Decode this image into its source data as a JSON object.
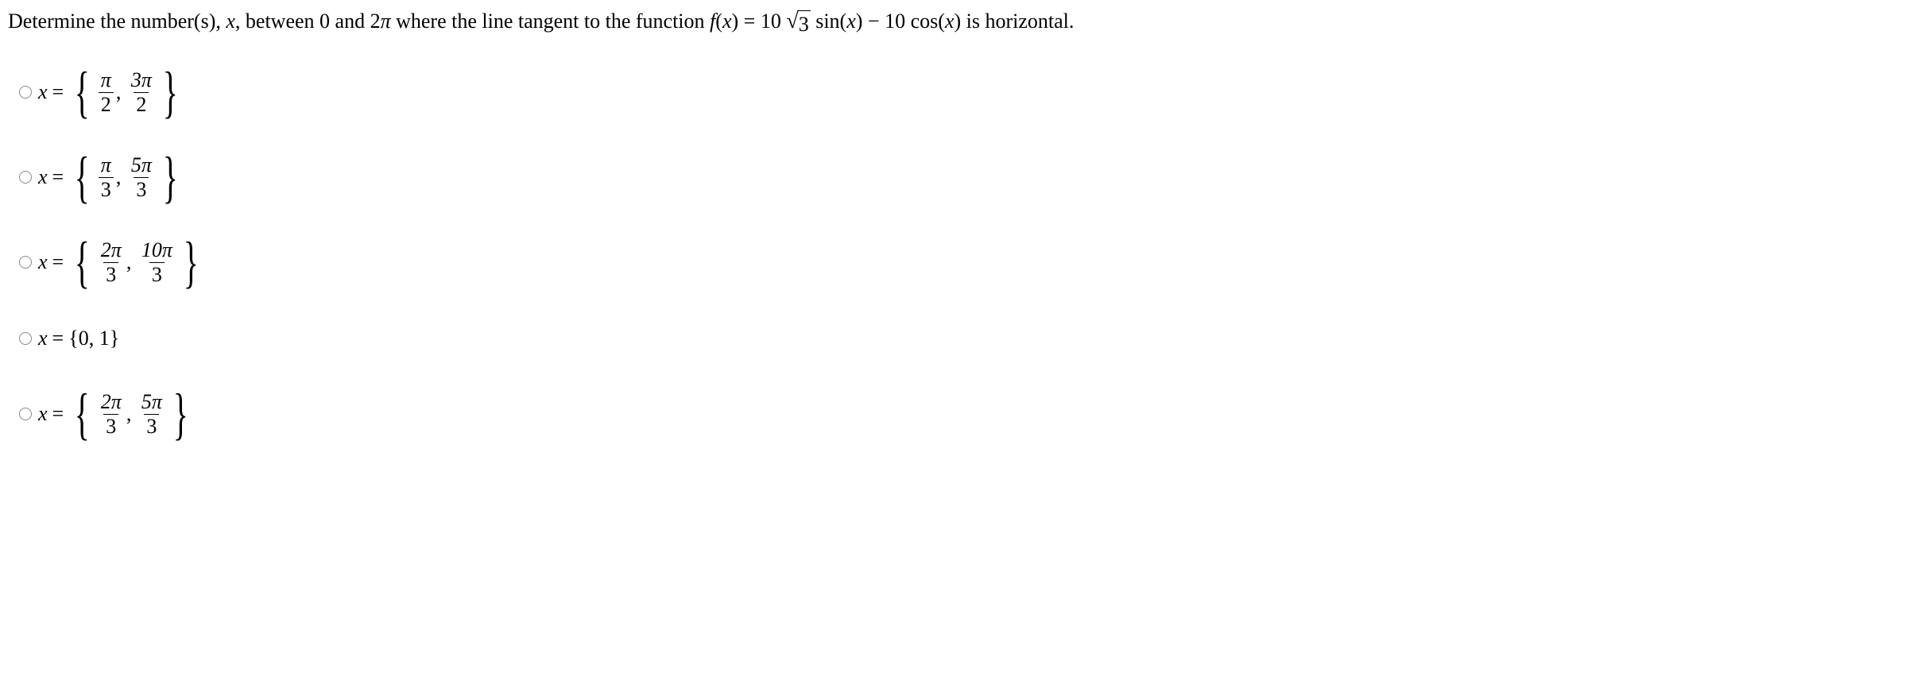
{
  "question": {
    "prefix": "Determine the number(s), ",
    "var1": "x",
    "mid1": ", between 0 and 2",
    "pi1": "π",
    "mid2": " where the line tangent to the function ",
    "fx": "f",
    "paren_open": "(",
    "xarg": "x",
    "paren_close": ")",
    "eq": " = ",
    "coef1": "10 ",
    "sqrt_arg": "3",
    "sin": " sin(",
    "x2": "x",
    "close1": ") − 10 cos(",
    "x3": "x",
    "close2": ") is horizontal."
  },
  "labels": {
    "xeq": "x",
    "equals": "="
  },
  "options": [
    {
      "type": "frac_pair",
      "a_num": "π",
      "a_den": "2",
      "b_num": "3π",
      "b_den": "2"
    },
    {
      "type": "frac_pair",
      "a_num": "π",
      "a_den": "3",
      "b_num": "5π",
      "b_den": "3"
    },
    {
      "type": "frac_pair",
      "a_num": "2π",
      "a_den": "3",
      "b_num": "10π",
      "b_den": "3"
    },
    {
      "type": "simple",
      "content": "{0, 1}"
    },
    {
      "type": "frac_pair",
      "a_num": "2π",
      "a_den": "3",
      "b_num": "5π",
      "b_den": "3"
    }
  ]
}
